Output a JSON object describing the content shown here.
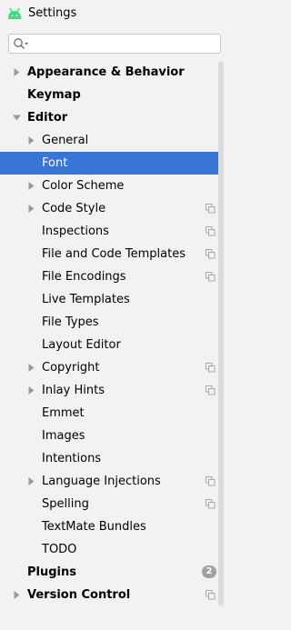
{
  "window": {
    "title": "Settings"
  },
  "search": {
    "value": "",
    "placeholder": ""
  },
  "tree": {
    "items": [
      {
        "label": "Appearance & Behavior",
        "level": 0,
        "expanded": false,
        "has_children": true,
        "bold": true
      },
      {
        "label": "Keymap",
        "level": 0,
        "has_children": false,
        "bold": true
      },
      {
        "label": "Editor",
        "level": 0,
        "expanded": true,
        "has_children": true,
        "bold": true
      },
      {
        "label": "General",
        "level": 1,
        "expanded": false,
        "has_children": true
      },
      {
        "label": "Font",
        "level": 1,
        "has_children": false,
        "selected": true
      },
      {
        "label": "Color Scheme",
        "level": 1,
        "expanded": false,
        "has_children": true
      },
      {
        "label": "Code Style",
        "level": 1,
        "expanded": false,
        "has_children": true,
        "project_icon": true
      },
      {
        "label": "Inspections",
        "level": 1,
        "has_children": false,
        "project_icon": true
      },
      {
        "label": "File and Code Templates",
        "level": 1,
        "has_children": false,
        "project_icon": true
      },
      {
        "label": "File Encodings",
        "level": 1,
        "has_children": false,
        "project_icon": true
      },
      {
        "label": "Live Templates",
        "level": 1,
        "has_children": false
      },
      {
        "label": "File Types",
        "level": 1,
        "has_children": false
      },
      {
        "label": "Layout Editor",
        "level": 1,
        "has_children": false
      },
      {
        "label": "Copyright",
        "level": 1,
        "expanded": false,
        "has_children": true,
        "project_icon": true
      },
      {
        "label": "Inlay Hints",
        "level": 1,
        "expanded": false,
        "has_children": true,
        "project_icon": true
      },
      {
        "label": "Emmet",
        "level": 1,
        "has_children": false
      },
      {
        "label": "Images",
        "level": 1,
        "has_children": false
      },
      {
        "label": "Intentions",
        "level": 1,
        "has_children": false
      },
      {
        "label": "Language Injections",
        "level": 1,
        "expanded": false,
        "has_children": true,
        "project_icon": true
      },
      {
        "label": "Spelling",
        "level": 1,
        "has_children": false,
        "project_icon": true
      },
      {
        "label": "TextMate Bundles",
        "level": 1,
        "has_children": false
      },
      {
        "label": "TODO",
        "level": 1,
        "has_children": false
      },
      {
        "label": "Plugins",
        "level": 0,
        "has_children": false,
        "bold": true,
        "badge": "2"
      },
      {
        "label": "Version Control",
        "level": 0,
        "expanded": false,
        "has_children": true,
        "bold": true,
        "project_icon": true
      }
    ]
  },
  "colors": {
    "selection": "#3875d7",
    "background": "#f2f2f2",
    "android_green": "#3ddc84"
  },
  "icons": {
    "app": "android-icon",
    "search": "search-icon",
    "collapsed": "triangle-right-icon",
    "expanded": "triangle-down-icon",
    "project_scope": "copy-icon"
  }
}
